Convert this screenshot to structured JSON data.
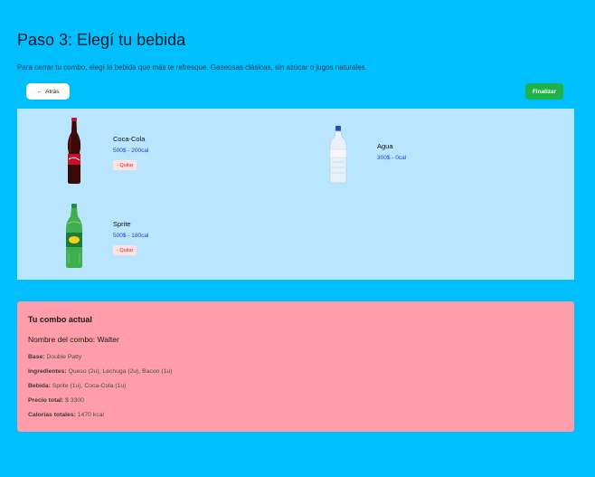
{
  "header": {
    "title": "Paso 3: Elegí tu bebida",
    "subtitle": "Para cerrar tu combo, elegí la bebida que más te refresque. Gaseosas clásicas, sin azúcar o jugos naturales."
  },
  "nav": {
    "back_icon": "←",
    "back_label": "Atrás",
    "finish_label": "Finalizar"
  },
  "drinks": [
    {
      "name": "Coca-Cola",
      "info": "500$ - 200cal",
      "remove_label": "- Quitar",
      "selected": true,
      "icon": "cola-bottle"
    },
    {
      "name": "Agua",
      "info": "300$ - 0cal",
      "selected": false,
      "icon": "water-bottle"
    },
    {
      "name": "Sprite",
      "info": "500$ - 180cal",
      "remove_label": "- Quitar",
      "selected": true,
      "icon": "sprite-bottle"
    }
  ],
  "summary": {
    "title": "Tu combo actual",
    "name_label": "Nombre del combo:",
    "name_value": "Walter",
    "lines": [
      {
        "label": "Base:",
        "value": "Double Patty"
      },
      {
        "label": "Ingredientes:",
        "value": "Queso (2u), Lechuga (2u), Bacon (1u)"
      },
      {
        "label": "Bebida:",
        "value": "Sprite (1u), Coca-Cola (1u)"
      },
      {
        "label": "Precio total:",
        "value": "$ 3300"
      },
      {
        "label": "Calorías totales:",
        "value": "1470 kcal"
      }
    ]
  },
  "colors": {
    "background": "#00bfff",
    "drinks_panel": "#b9e5ff",
    "summary_panel": "#ff9eaa",
    "finish_button": "#1fb24a",
    "price_text": "#1c3fd6",
    "remove_text": "#d4222e"
  }
}
